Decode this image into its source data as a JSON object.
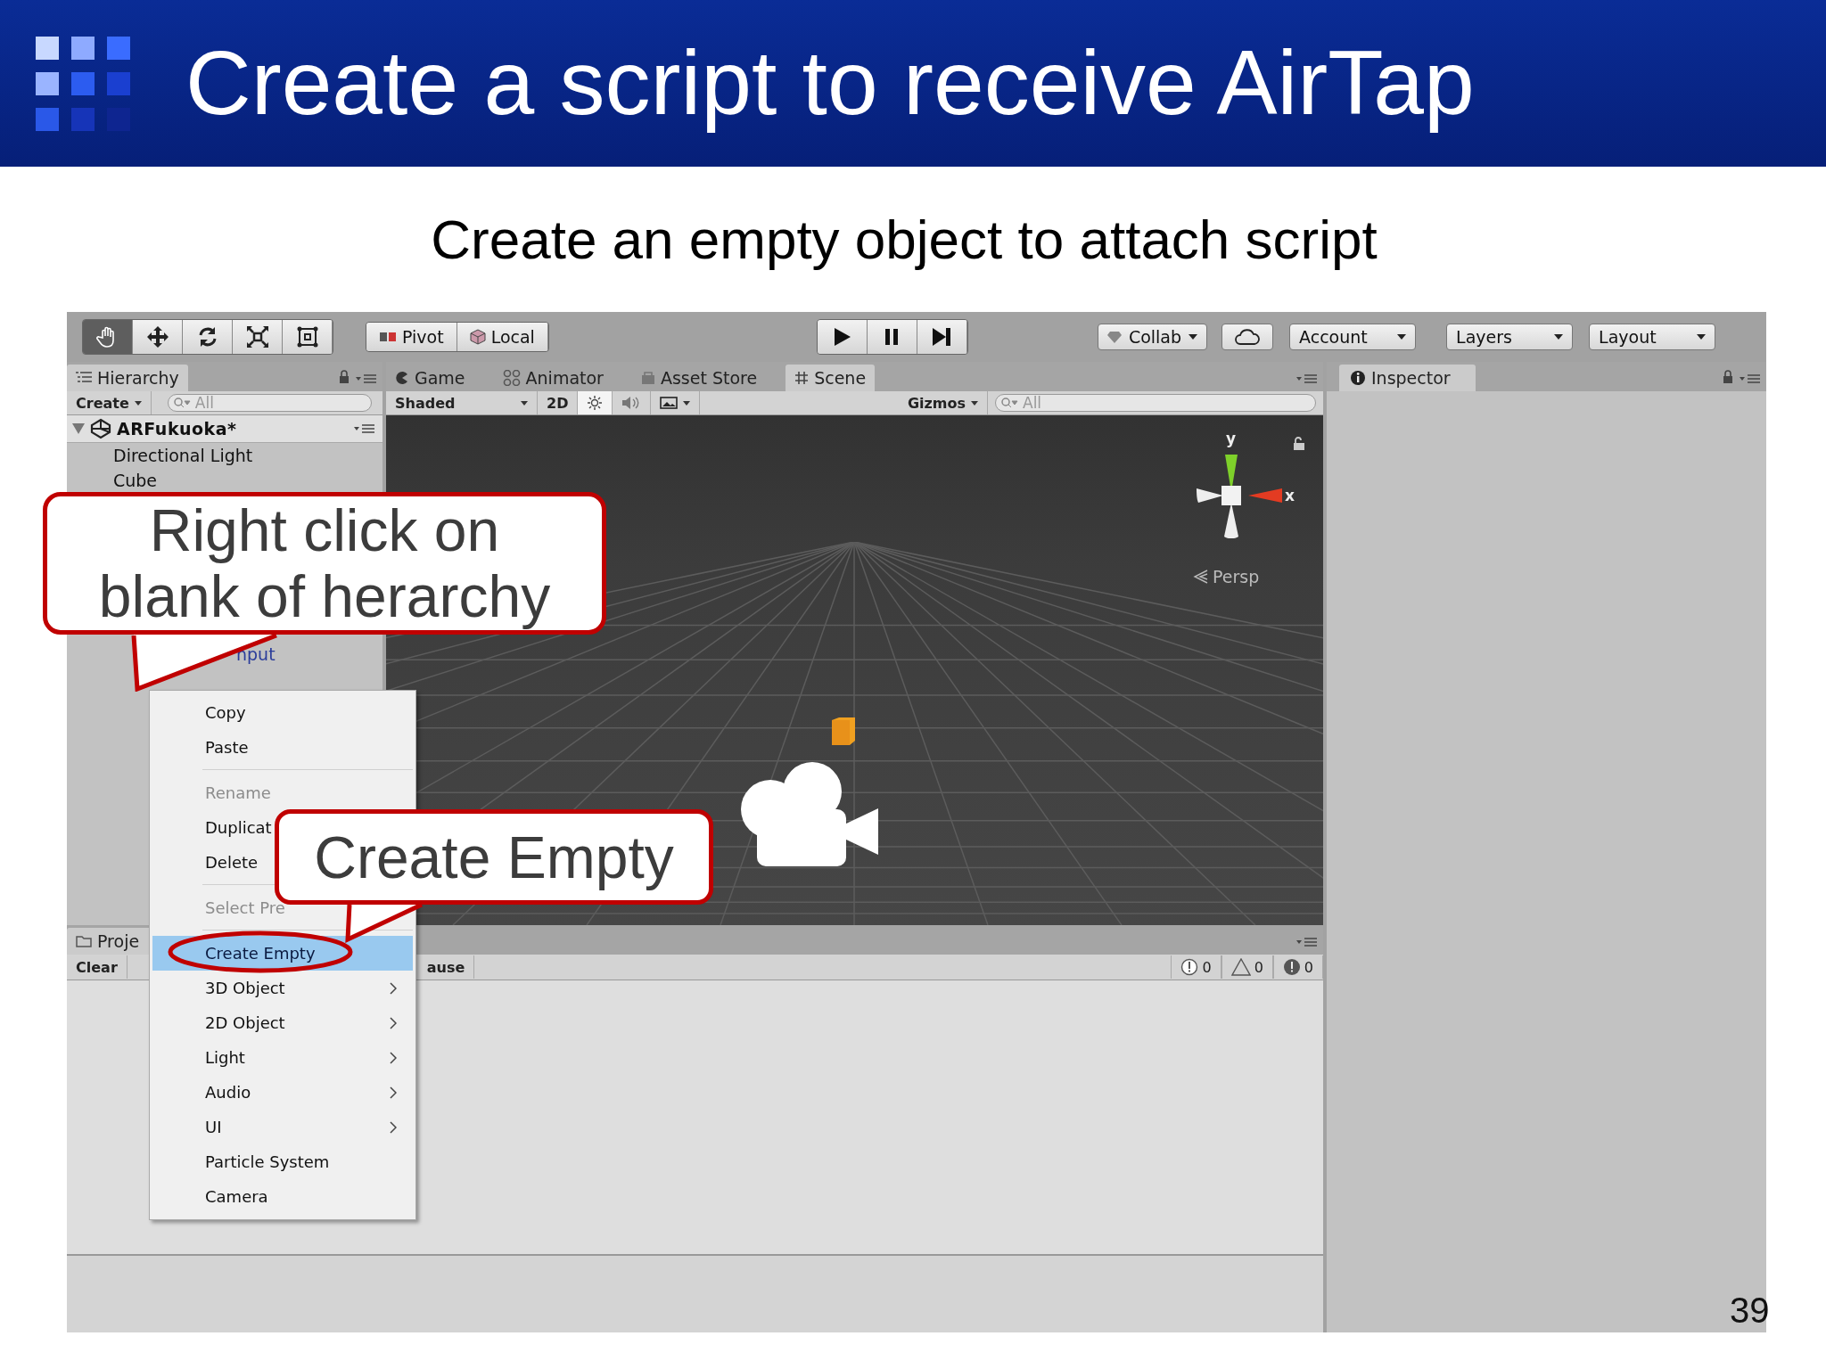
{
  "slide": {
    "title": "Create a script to receive AirTap",
    "subtitle": "Create an empty object to attach script",
    "page_number": "39"
  },
  "toolbar": {
    "tools": [
      {
        "kind": "hand",
        "selected": true
      },
      {
        "kind": "move",
        "selected": false
      },
      {
        "kind": "rotate",
        "selected": false
      },
      {
        "kind": "scale",
        "selected": false
      },
      {
        "kind": "rect",
        "selected": false
      }
    ],
    "pivot": "Pivot",
    "space": "Local",
    "collab": "Collab",
    "account": "Account",
    "layers": "Layers",
    "layout": "Layout"
  },
  "hierarchy": {
    "tab": "Hierarchy",
    "create": "Create",
    "search_placeholder": "All",
    "scene": "ARFukuoka*",
    "items": [
      "Directional Light",
      "Cube"
    ],
    "partial_item": "nput"
  },
  "scene_tabs": [
    {
      "label": "Game",
      "kind": "game",
      "selected": false
    },
    {
      "label": "Animator",
      "kind": "animator",
      "selected": false
    },
    {
      "label": "Asset Store",
      "kind": "store",
      "selected": false
    },
    {
      "label": "Scene",
      "kind": "scene",
      "selected": true
    }
  ],
  "scene_toolbar": {
    "shading": "Shaded",
    "mode_2d": "2D",
    "lighting_on": true,
    "audio_on": false,
    "gizmos": "Gizmos",
    "search_placeholder": "All"
  },
  "gizmo": {
    "y_label": "y",
    "x_label": "x",
    "projection": "Persp"
  },
  "inspector": {
    "tab": "Inspector"
  },
  "bottom": {
    "tab": "Proje",
    "clear": "Clear",
    "cut_label": "ause",
    "counts": [
      {
        "kind": "info",
        "value": "0"
      },
      {
        "kind": "warning",
        "value": "0"
      },
      {
        "kind": "error",
        "value": "0"
      }
    ]
  },
  "context_menu": [
    {
      "label": "Copy",
      "disabled": false,
      "selected": false,
      "submenu": false,
      "separator_after": false
    },
    {
      "label": "Paste",
      "disabled": false,
      "selected": false,
      "submenu": false,
      "separator_after": true
    },
    {
      "label": "Rename",
      "disabled": true,
      "selected": false,
      "submenu": false,
      "separator_after": false
    },
    {
      "label": "Duplicat",
      "disabled": false,
      "selected": false,
      "separator_after": false
    },
    {
      "label": "Delete",
      "disabled": false,
      "selected": false,
      "submenu": false,
      "separator_after": true
    },
    {
      "label": "Select Pre",
      "disabled": true,
      "selected": false,
      "submenu": false,
      "separator_after": true
    },
    {
      "label": "Create Empty",
      "disabled": false,
      "selected": true,
      "submenu": false,
      "separator_after": false
    },
    {
      "label": "3D Object",
      "disabled": false,
      "selected": false,
      "submenu": true,
      "separator_after": false
    },
    {
      "label": "2D Object",
      "disabled": false,
      "selected": false,
      "submenu": true,
      "separator_after": false
    },
    {
      "label": "Light",
      "disabled": false,
      "selected": false,
      "submenu": true,
      "separator_after": false
    },
    {
      "label": "Audio",
      "disabled": false,
      "selected": false,
      "submenu": true,
      "separator_after": false
    },
    {
      "label": "UI",
      "disabled": false,
      "selected": false,
      "submenu": true,
      "separator_after": false
    },
    {
      "label": "Particle System",
      "disabled": false,
      "selected": false,
      "submenu": false,
      "separator_after": false
    },
    {
      "label": "Camera",
      "disabled": false,
      "selected": false,
      "submenu": false,
      "separator_after": false
    }
  ],
  "callouts": [
    {
      "text": "Right click on blank of herarchy"
    },
    {
      "text": "Create Empty"
    }
  ]
}
